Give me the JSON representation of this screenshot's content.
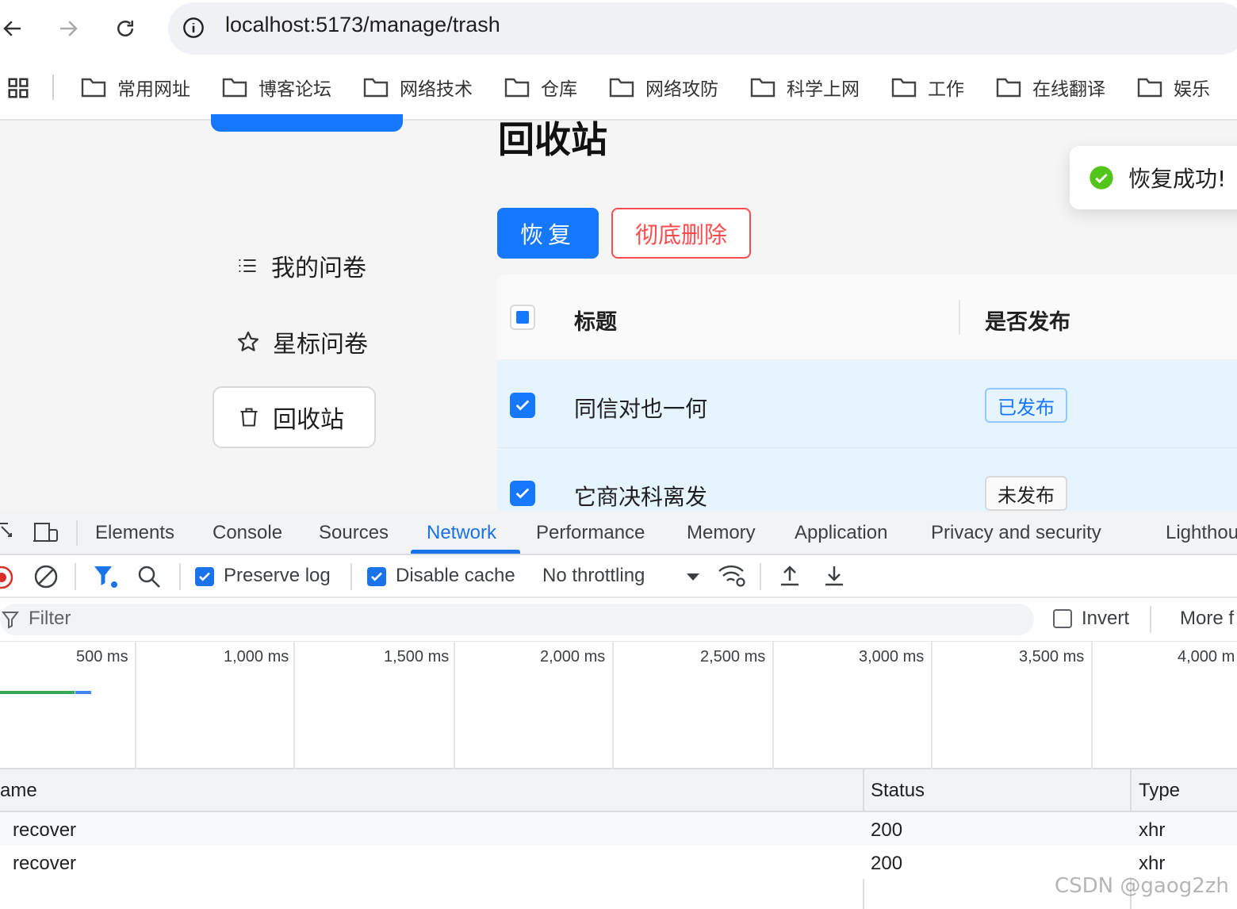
{
  "browser": {
    "url": "localhost:5173/manage/trash",
    "bookmarks": [
      "常用网址",
      "博客论坛",
      "网络技术",
      "仓库",
      "网络攻防",
      "科学上网",
      "工作",
      "在线翻译",
      "娱乐"
    ]
  },
  "app": {
    "page_title": "回收站",
    "menu": {
      "my_surveys": "我的问卷",
      "starred": "星标问卷",
      "trash": "回收站"
    },
    "actions": {
      "recover": "恢复",
      "delete_forever": "彻底删除"
    },
    "table": {
      "headers": {
        "title": "标题",
        "published": "是否发布"
      },
      "rows": [
        {
          "title": "同信对也一何",
          "status": "已发布"
        },
        {
          "title": "它商决科离发",
          "status": "未发布"
        }
      ]
    },
    "toast": "恢复成功!"
  },
  "devtools": {
    "tabs": [
      "Elements",
      "Console",
      "Sources",
      "Network",
      "Performance",
      "Memory",
      "Application",
      "Privacy and security",
      "Lighthou"
    ],
    "toolbar": {
      "preserve_log": "Preserve log",
      "disable_cache": "Disable cache",
      "throttling": "No throttling"
    },
    "filter": {
      "placeholder": "Filter",
      "invert": "Invert",
      "more": "More f"
    },
    "timeline_labels": [
      "500 ms",
      "1,000 ms",
      "1,500 ms",
      "2,000 ms",
      "2,500 ms",
      "3,000 ms",
      "3,500 ms",
      "4,000 m"
    ],
    "columns": {
      "name": "ame",
      "status": "Status",
      "type": "Type"
    },
    "requests": [
      {
        "name": "recover",
        "status": "200",
        "type": "xhr"
      },
      {
        "name": "recover",
        "status": "200",
        "type": "xhr"
      }
    ]
  },
  "watermark": "CSDN @gaog2zh",
  "colors": {
    "primary": "#1677ff",
    "danger": "#ff4d4f",
    "devtools_accent": "#1a73e8",
    "success": "#52c41a"
  }
}
